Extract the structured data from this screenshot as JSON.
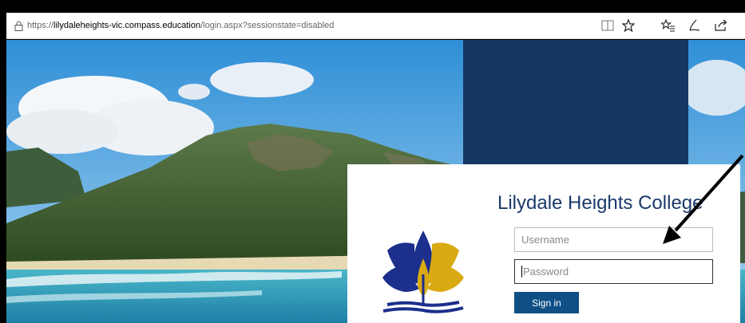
{
  "browser": {
    "url_scheme": "https://",
    "url_host": "lilydaleheights-vic.compass.education",
    "url_path": "/login.aspx?sessionstate=disabled",
    "icons": [
      "lock-icon",
      "reading-view-icon",
      "favorite-star-icon",
      "favorites-list-icon",
      "pen-icon",
      "share-icon"
    ]
  },
  "login": {
    "college_name": "Lilydale Heights College",
    "username_placeholder": "Username",
    "password_placeholder": "Password",
    "signin_label": "Sign in"
  },
  "colors": {
    "navy": "#163763",
    "title": "#1b3a6b",
    "button": "#0f4f86",
    "logo_blue": "#1c2f8c",
    "logo_gold": "#d9a912"
  }
}
